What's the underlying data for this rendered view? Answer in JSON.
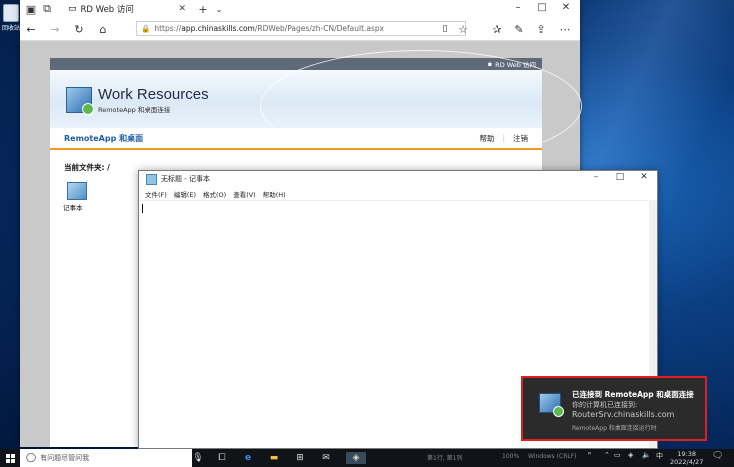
{
  "desktop": {
    "icon_label": "回收站"
  },
  "browser": {
    "tab_title": "RD Web 访问",
    "url_prefix": "https://",
    "url_domain": "app.chinaskills.com",
    "url_path": "/RDWeb/Pages/zh-CN/Default.aspx"
  },
  "rdweb": {
    "top_link": "RD Web 访问",
    "title": "Work Resources",
    "subtitle": "RemoteApp 和桌面连接",
    "nav_left": "RemoteApp 和桌面",
    "help": "帮助",
    "logout": "注销",
    "current_folder": "当前文件夹: /",
    "app_label": "记事本"
  },
  "notepad": {
    "title": "无标题 - 记事本",
    "menu": [
      "文件(F)",
      "编辑(E)",
      "格式(O)",
      "查看(V)",
      "帮助(H)"
    ]
  },
  "toast": {
    "title": "已连接到 RemoteApp 和桌面连接",
    "line1": "你的计算机已连接到:",
    "line2": "RouterSrv.chinaskills.com",
    "line3": "RemoteApp 和桌面连接运行时"
  },
  "taskbar": {
    "search_placeholder": "有问题尽管问我",
    "status_row": "第1行, 第1列",
    "zoom": "100%",
    "encoding": "Windows (CRLF)",
    "ime": "中",
    "time": "19:38",
    "date": "2022/4/27"
  }
}
